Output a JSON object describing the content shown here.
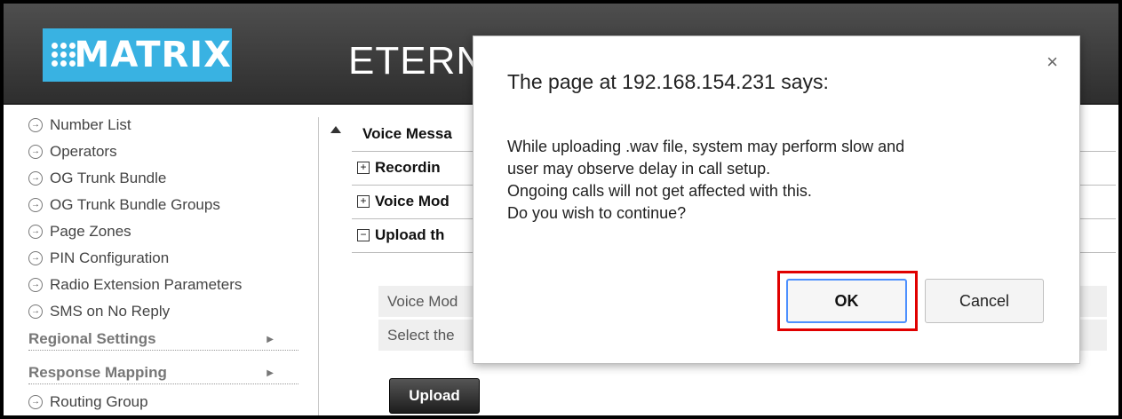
{
  "header": {
    "logo_text": "MATRIX",
    "app_title": "ETERNIT"
  },
  "sidebar": {
    "items": [
      {
        "label": "Number List"
      },
      {
        "label": "Operators"
      },
      {
        "label": "OG Trunk Bundle"
      },
      {
        "label": "OG Trunk Bundle Groups"
      },
      {
        "label": "Page Zones"
      },
      {
        "label": "PIN Configuration"
      },
      {
        "label": "Radio Extension Parameters"
      },
      {
        "label": "SMS on No Reply"
      }
    ],
    "sections": [
      {
        "label": "Regional Settings"
      },
      {
        "label": "Response Mapping"
      }
    ],
    "last_item": {
      "label": "Routing Group"
    }
  },
  "main": {
    "rows": [
      {
        "label": "Voice Messa"
      },
      {
        "label": "Recordin",
        "expander": "+"
      },
      {
        "label": "Voice Mod",
        "expander": "+"
      },
      {
        "label": "Upload th",
        "expander": "−"
      }
    ],
    "form": [
      {
        "label": "Voice Mod"
      },
      {
        "label": "Select the"
      }
    ],
    "upload_label": "Upload"
  },
  "dialog": {
    "title": "The page at 192.168.154.231 says:",
    "close_glyph": "×",
    "message_lines": [
      "While uploading .wav file, system may perform slow and",
      "user may observe delay in call setup.",
      "Ongoing calls will not get affected with this.",
      "Do you wish to continue?"
    ],
    "ok_label": "OK",
    "cancel_label": "Cancel",
    "highlight_color": "#e00000"
  }
}
